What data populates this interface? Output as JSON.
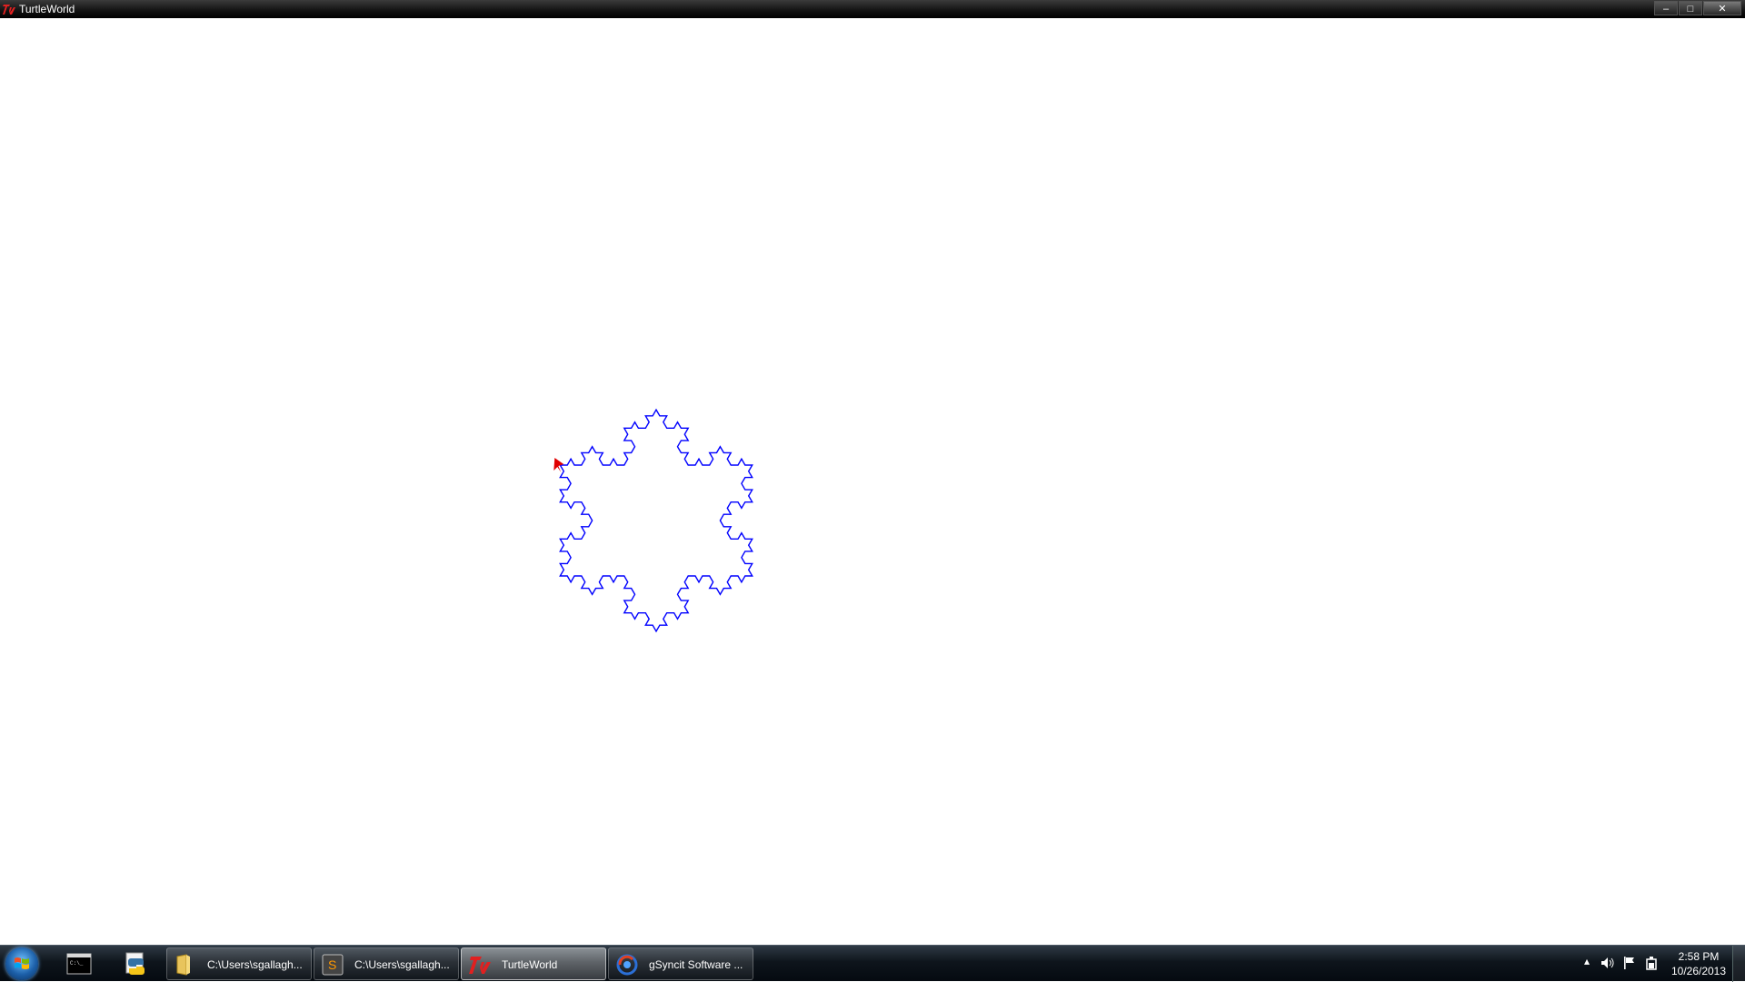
{
  "window": {
    "title": "TurtleWorld",
    "controls": {
      "minimize": "–",
      "maximize": "□",
      "close": "✕"
    }
  },
  "canvas": {
    "drawing": "koch-snowflake",
    "stroke_color": "#0000ff",
    "turtle_color": "#e00000",
    "recursion_level": 3
  },
  "taskbar": {
    "start_icon": "windows-start-orb",
    "pinned": [
      {
        "name": "command-prompt",
        "icon": "cmd-icon"
      },
      {
        "name": "python",
        "icon": "python-icon"
      }
    ],
    "tasks": [
      {
        "label": "C:\\Users\\sgallagh...",
        "icon": "folder-icon"
      },
      {
        "label": "C:\\Users\\sgallagh...",
        "icon": "sublime-text-icon"
      },
      {
        "label": "TurtleWorld",
        "icon": "tk-icon",
        "active": true
      },
      {
        "label": "gSyncit Software ...",
        "icon": "gsyncit-icon"
      }
    ],
    "tray": {
      "icons": [
        "show-hidden-icons",
        "volume-icon",
        "action-center-flag-icon",
        "power-icon"
      ],
      "time": "2:58 PM",
      "date": "10/26/2013"
    }
  }
}
